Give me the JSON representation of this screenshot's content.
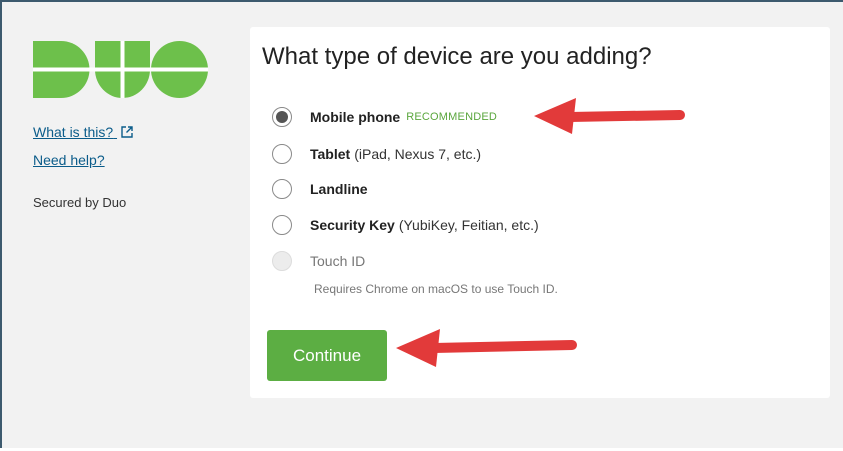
{
  "left": {
    "logo_text": "DUO",
    "links": [
      {
        "label": "What is this?",
        "icon": "external-link-icon"
      },
      {
        "label": "Need help?"
      }
    ],
    "secured": "Secured by Duo"
  },
  "card": {
    "title": "What type of device are you adding?",
    "options": [
      {
        "name": "Mobile phone",
        "detail": "",
        "badge": "RECOMMENDED",
        "selected": true
      },
      {
        "name": "Tablet",
        "detail": "(iPad, Nexus 7, etc.)"
      },
      {
        "name": "Landline",
        "detail": ""
      },
      {
        "name": "Security Key",
        "detail": "(YubiKey, Feitian, etc.)"
      },
      {
        "name": "Touch ID",
        "detail": "",
        "disabled": true
      }
    ],
    "touch_id_hint": "Requires Chrome on macOS to use Touch ID.",
    "continue_label": "Continue"
  },
  "colors": {
    "brand_green": "#6dc04b",
    "button_green": "#5cae43",
    "badge_green": "#5aa63d",
    "annotation_red": "#e23a3a",
    "link_blue": "#0b5c8a"
  }
}
